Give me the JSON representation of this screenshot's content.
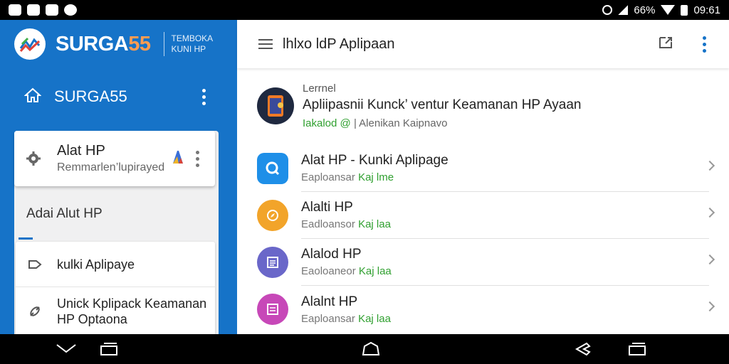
{
  "status_bar": {
    "battery": "66%",
    "time": "09:61"
  },
  "brand": {
    "name_main": "SURGA",
    "name_highlight": "55",
    "subtitle": "TEMBOKA KUNI HP"
  },
  "sidebar": {
    "header_title": "SURGA55",
    "card": {
      "title": "Alat HP",
      "subtitle": "Remmarlen’lupirayed"
    },
    "section_label": "Adai Alut HP",
    "menu_items": [
      {
        "label": "kulki Aplipaye",
        "icon": "login-icon"
      },
      {
        "label": "Unick Kplipack Keamanan HP Optaona",
        "icon": "link-icon"
      }
    ]
  },
  "main": {
    "title": "lhlxo ldP Aplipaan",
    "featured": {
      "overline": "Lerrnel",
      "title": "Apliipasnii Kunck’ ventur Keamanan HP Ayaan",
      "sub_green": "Iakalod @",
      "sub_gray": "| Alenikan Kaipnavo"
    },
    "apps": [
      {
        "title": "Alat HP - Kunki Aplipage",
        "sub_gray": "Eaploansar",
        "sub_green": "Kaj lme",
        "icon_color": "#1e8fe8",
        "icon": "search-icon"
      },
      {
        "title": "Alalti HP",
        "sub_gray": "Eadloansor",
        "sub_green": "Kaj laa",
        "icon_color": "#f2a42a",
        "icon": "compass-icon"
      },
      {
        "title": "Alalod HP",
        "sub_gray": "Eaoloaneor",
        "sub_green": "Kaj laa",
        "icon_color": "#6a67c9",
        "icon": "document-icon"
      },
      {
        "title": "Alalnt HP",
        "sub_gray": "Eaploansar",
        "sub_green": "Kaj laa",
        "icon_color": "#c748b8",
        "icon": "image-icon"
      }
    ]
  },
  "colors": {
    "primary": "#1673c8",
    "accent": "#ff9c52",
    "green": "#30a030"
  }
}
